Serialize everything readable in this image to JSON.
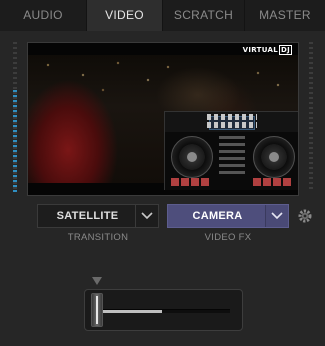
{
  "tabs": [
    {
      "label": "AUDIO",
      "active": false
    },
    {
      "label": "VIDEO",
      "active": true
    },
    {
      "label": "SCRATCH",
      "active": false
    },
    {
      "label": "MASTER",
      "active": false
    }
  ],
  "video": {
    "watermark_text": "VIRTUAL",
    "watermark_badge": "DJ"
  },
  "transition": {
    "value": "SATELLITE",
    "caption": "TRANSITION"
  },
  "video_fx": {
    "value": "CAMERA",
    "caption": "VIDEO FX"
  },
  "crossfader": {
    "position": 0.0,
    "level": 0.48
  },
  "vu_meter": {
    "left_level": 0.68,
    "right_level": 0.0
  },
  "icons": {
    "dropdown": "chevron-down-icon",
    "settings": "gear-icon",
    "marker": "triangle-down-icon"
  },
  "colors": {
    "accent_fx": "#4e4e7c",
    "vu_active": "#2f8fc2",
    "active_tab_bg": "#2e2e2e"
  }
}
